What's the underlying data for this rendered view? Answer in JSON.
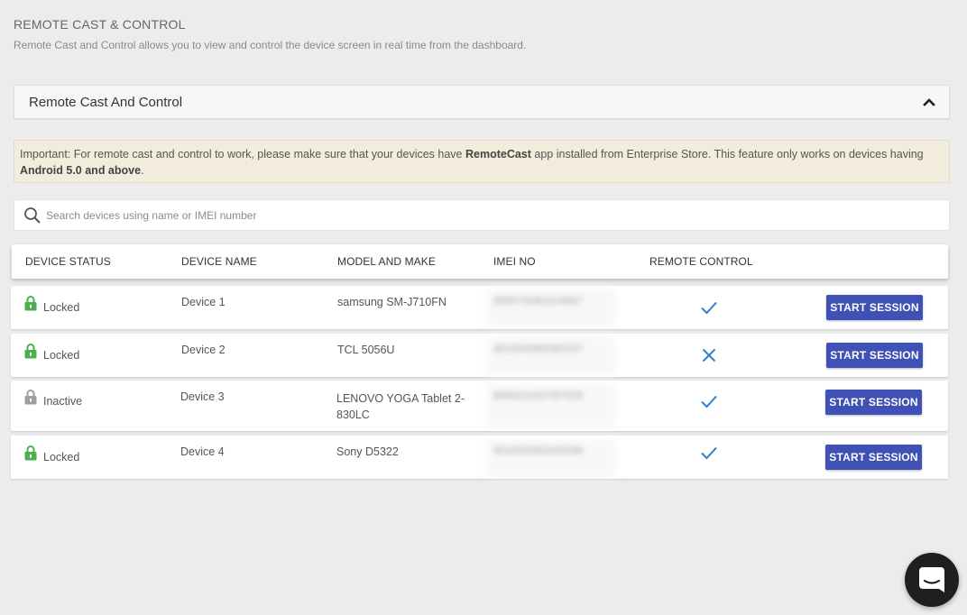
{
  "page": {
    "title": "REMOTE CAST & CONTROL",
    "subtitle": "Remote Cast and Control allows you to view and control the device screen in real time from the dashboard."
  },
  "panel": {
    "title": "Remote Cast And Control",
    "toggle_icon": "chevron-up-icon"
  },
  "notice": {
    "text_1": "Important: For remote cast and control to work, please make sure that your devices have ",
    "bold_1": "RemoteCast",
    "text_2": " app installed from Enterprise Store. This feature only works on devices having ",
    "bold_2": "Android 5.0 and above",
    "text_3": "."
  },
  "search": {
    "placeholder": "Search devices using name or IMEI number",
    "value": "",
    "icon": "search-icon"
  },
  "table": {
    "columns": {
      "status": "DEVICE STATUS",
      "name": "DEVICE NAME",
      "model": "MODEL AND MAKE",
      "imei": "IMEI NO",
      "remote": "REMOTE CONTROL"
    },
    "rows": [
      {
        "status": "Locked",
        "status_icon": "lock-icon",
        "status_color": "#4caf50",
        "name": "Device 1",
        "model": "samsung SM-J710FN",
        "imei": "355572081314667",
        "remote": "check-icon",
        "action": "START SESSION"
      },
      {
        "status": "Locked",
        "status_icon": "lock-icon",
        "status_color": "#4caf50",
        "name": "Device 2",
        "model": "TCL 5056U",
        "imei": "351554080080337",
        "remote": "cross-icon",
        "action": "START SESSION"
      },
      {
        "status": "Inactive",
        "status_icon": "lock-icon",
        "status_color": "#9e9e9e",
        "name": "Device 3",
        "model": "LENOVO YOGA Tablet 2-830LC",
        "imei": "865021022787029",
        "remote": "check-icon",
        "action": "START SESSION"
      },
      {
        "status": "Locked",
        "status_icon": "lock-icon",
        "status_color": "#4caf50",
        "name": "Device 4",
        "model": "Sony D5322",
        "imei": "351832062245296",
        "remote": "check-icon",
        "action": "START SESSION"
      }
    ]
  },
  "colors": {
    "accent": "#3f51b5",
    "check": "#2f7fd1",
    "locked": "#4caf50",
    "inactive": "#9e9e9e"
  },
  "chat": {
    "icon": "chat-icon"
  }
}
